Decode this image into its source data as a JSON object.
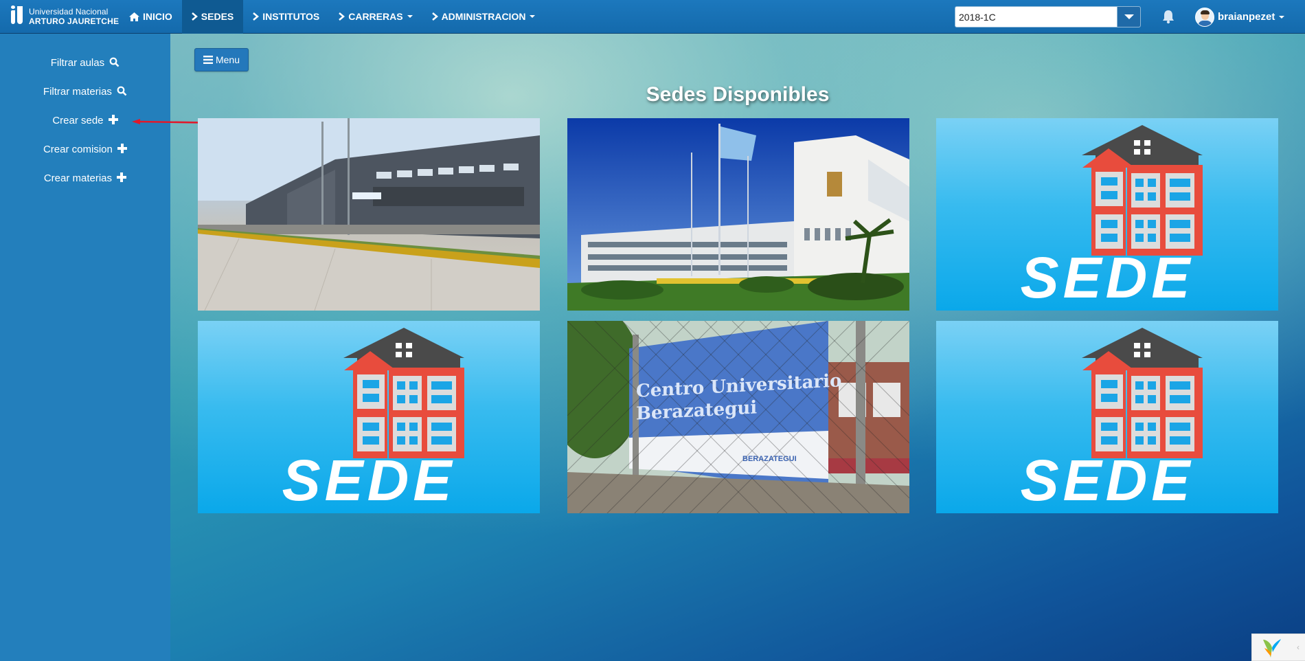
{
  "brand": {
    "line1": "Universidad Nacional",
    "line2": "ARTURO JAURETCHE"
  },
  "nav": {
    "items": [
      {
        "label": "INICIO",
        "icon": "home-icon",
        "dropdown": false,
        "active": false
      },
      {
        "label": "SEDES",
        "icon": "chevron-right-icon",
        "dropdown": false,
        "active": true
      },
      {
        "label": "INSTITUTOS",
        "icon": "chevron-right-icon",
        "dropdown": false,
        "active": false
      },
      {
        "label": "CARRERAS",
        "icon": "chevron-right-icon",
        "dropdown": true,
        "active": false
      },
      {
        "label": "ADMINISTRACION",
        "icon": "chevron-right-icon",
        "dropdown": true,
        "active": false
      }
    ],
    "period": "2018-1C",
    "username": "braianpezet"
  },
  "sidebar": {
    "items": [
      {
        "label": "Filtrar aulas",
        "icon": "search-icon"
      },
      {
        "label": "Filtrar materias",
        "icon": "search-icon"
      },
      {
        "label": "Crear sede",
        "icon": "plus-icon"
      },
      {
        "label": "Crear comision",
        "icon": "plus-icon"
      },
      {
        "label": "Crear materias",
        "icon": "plus-icon"
      }
    ]
  },
  "main": {
    "menu_button": "Menu",
    "title": "Sedes Disponibles",
    "sede_placeholder_text": "SEDE",
    "cards": [
      {
        "kind": "photo",
        "image": "campus-building-photo"
      },
      {
        "kind": "photo",
        "image": "main-building-flags-photo"
      },
      {
        "kind": "placeholder",
        "image": "sede-building-illustration"
      },
      {
        "kind": "placeholder",
        "image": "sede-building-illustration"
      },
      {
        "kind": "photo",
        "image": "berazategui-fence-photo",
        "sign_line1": "Centro Universitario",
        "sign_line2": "Berazategui",
        "sign_logo": "BERAZATEGUI"
      },
      {
        "kind": "placeholder",
        "image": "sede-building-illustration"
      }
    ]
  },
  "colors": {
    "navbar": "#1c78bd",
    "sidebar": "#237fbc",
    "sede_bg": "#0aa8ea",
    "building_red": "#e84c3d",
    "roof_gray": "#4a4a4a",
    "arrow_red": "#e0192b"
  }
}
